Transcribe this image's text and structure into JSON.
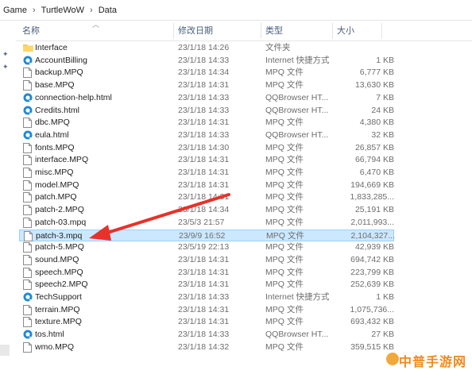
{
  "breadcrumb": {
    "items": [
      "Game",
      "TurtleWoW",
      "Data"
    ],
    "separator": "›"
  },
  "columns": {
    "name": "名称",
    "date": "修改日期",
    "type": "类型",
    "size": "大小"
  },
  "files": [
    {
      "name": "Interface",
      "date": "23/1/18 14:26",
      "type": "文件夹",
      "size": "",
      "icon": "folder-icon"
    },
    {
      "name": "AccountBilling",
      "date": "23/1/18 14:33",
      "type": "Internet 快捷方式",
      "size": "1 KB",
      "icon": "internet-shortcut-icon"
    },
    {
      "name": "backup.MPQ",
      "date": "23/1/18 14:34",
      "type": "MPQ 文件",
      "size": "6,777 KB",
      "icon": "file-icon"
    },
    {
      "name": "base.MPQ",
      "date": "23/1/18 14:31",
      "type": "MPQ 文件",
      "size": "13,630 KB",
      "icon": "file-icon"
    },
    {
      "name": "connection-help.html",
      "date": "23/1/18 14:33",
      "type": "QQBrowser HT...",
      "size": "7 KB",
      "icon": "browser-icon"
    },
    {
      "name": "Credits.html",
      "date": "23/1/18 14:33",
      "type": "QQBrowser HT...",
      "size": "24 KB",
      "icon": "browser-icon"
    },
    {
      "name": "dbc.MPQ",
      "date": "23/1/18 14:31",
      "type": "MPQ 文件",
      "size": "4,380 KB",
      "icon": "file-icon"
    },
    {
      "name": "eula.html",
      "date": "23/1/18 14:33",
      "type": "QQBrowser HT...",
      "size": "32 KB",
      "icon": "browser-icon"
    },
    {
      "name": "fonts.MPQ",
      "date": "23/1/18 14:30",
      "type": "MPQ 文件",
      "size": "26,857 KB",
      "icon": "file-icon"
    },
    {
      "name": "interface.MPQ",
      "date": "23/1/18 14:31",
      "type": "MPQ 文件",
      "size": "66,794 KB",
      "icon": "file-icon"
    },
    {
      "name": "misc.MPQ",
      "date": "23/1/18 14:31",
      "type": "MPQ 文件",
      "size": "6,470 KB",
      "icon": "file-icon"
    },
    {
      "name": "model.MPQ",
      "date": "23/1/18 14:31",
      "type": "MPQ 文件",
      "size": "194,669 KB",
      "icon": "file-icon"
    },
    {
      "name": "patch.MPQ",
      "date": "23/1/18 14:31",
      "type": "MPQ 文件",
      "size": "1,833,285...",
      "icon": "file-icon"
    },
    {
      "name": "patch-2.MPQ",
      "date": "23/1/18 14:34",
      "type": "MPQ 文件",
      "size": "25,191 KB",
      "icon": "file-icon"
    },
    {
      "name": "patch-03.mpq",
      "date": "23/5/3 21:57",
      "type": "MPQ 文件",
      "size": "2,011,993...",
      "icon": "file-icon"
    },
    {
      "name": "patch-3.mpq",
      "date": "23/9/9 16:52",
      "type": "MPQ 文件",
      "size": "2,104,327...",
      "icon": "file-icon",
      "selected": true
    },
    {
      "name": "patch-5.MPQ",
      "date": "23/5/19 22:13",
      "type": "MPQ 文件",
      "size": "42,939 KB",
      "icon": "file-icon"
    },
    {
      "name": "sound.MPQ",
      "date": "23/1/18 14:31",
      "type": "MPQ 文件",
      "size": "694,742 KB",
      "icon": "file-icon"
    },
    {
      "name": "speech.MPQ",
      "date": "23/1/18 14:31",
      "type": "MPQ 文件",
      "size": "223,799 KB",
      "icon": "file-icon"
    },
    {
      "name": "speech2.MPQ",
      "date": "23/1/18 14:31",
      "type": "MPQ 文件",
      "size": "252,639 KB",
      "icon": "file-icon"
    },
    {
      "name": "TechSupport",
      "date": "23/1/18 14:33",
      "type": "Internet 快捷方式",
      "size": "1 KB",
      "icon": "internet-shortcut-icon"
    },
    {
      "name": "terrain.MPQ",
      "date": "23/1/18 14:31",
      "type": "MPQ 文件",
      "size": "1,075,736...",
      "icon": "file-icon"
    },
    {
      "name": "texture.MPQ",
      "date": "23/1/18 14:31",
      "type": "MPQ 文件",
      "size": "693,432 KB",
      "icon": "file-icon"
    },
    {
      "name": "tos.html",
      "date": "23/1/18 14:33",
      "type": "QQBrowser HT...",
      "size": "27 KB",
      "icon": "browser-icon"
    },
    {
      "name": "wmo.MPQ",
      "date": "23/1/18 14:32",
      "type": "MPQ 文件",
      "size": "359,515 KB",
      "icon": "file-icon"
    }
  ],
  "watermark": "中普手游网",
  "colors": {
    "selection": "#cce8ff",
    "selection_border": "#99d1ff",
    "annotation_arrow": "#e8312a",
    "folder": "#f4c955",
    "browser": "#1b8ad6"
  }
}
